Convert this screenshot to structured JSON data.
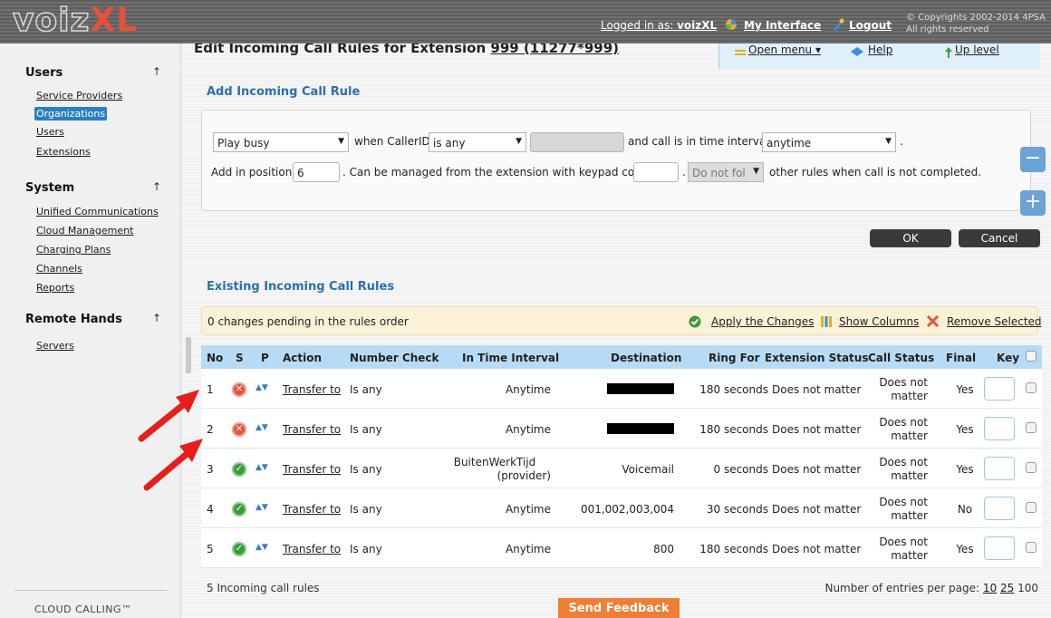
{
  "header": {
    "logo_part1": "voiz",
    "logo_part2": "XL",
    "logged_in_label": "Logged in as:",
    "logged_in_user": "voizXL",
    "my_interface": "My Interface",
    "logout": "Logout",
    "copyright_line1": "© Copyrights 2002-2014 4PSA",
    "copyright_line2": "All rights reserved"
  },
  "sidebar": {
    "sections": [
      {
        "title": "Users",
        "arrow": "↑",
        "items": [
          "Service Providers",
          "Organizations",
          "Users",
          "Extensions"
        ]
      },
      {
        "title": "System",
        "arrow": "↑",
        "items": [
          "Unified Communications",
          "Cloud Management",
          "Charging Plans",
          "Channels",
          "Reports"
        ]
      },
      {
        "title": "Remote Hands",
        "arrow": "↑",
        "items": [
          "Servers"
        ]
      }
    ],
    "active_item": "Organizations",
    "footer": "CLOUD CALLING™"
  },
  "page": {
    "title_prefix": "Edit Incoming Call Rules for Extension",
    "title_ext": "999 (11277*999)"
  },
  "toolbar": {
    "open_menu": "Open menu ▾",
    "help": "Help",
    "up_level": "Up level"
  },
  "add_rule": {
    "section_title": "Add Incoming Call Rule",
    "action_value": "Play busy",
    "when_callerid": "when CallerID",
    "callerid_value": "is any",
    "time_label": "and call is in time interval",
    "time_value": "anytime",
    "period": ".",
    "position_label": "Add in position",
    "position_value": "6",
    "keypad_label": ". Can be managed from the extension with keypad code",
    "dot": ".",
    "follow_value": "Do not fol",
    "follow_suffix": "other rules when call is not completed.",
    "ok": "OK",
    "cancel": "Cancel",
    "minus": "−",
    "plus": "+"
  },
  "existing": {
    "section_title": "Existing Incoming Call Rules",
    "pending_text": "0 changes pending in the rules order",
    "apply": "Apply the Changes",
    "show_columns": "Show Columns",
    "remove_selected": "Remove Selected",
    "columns": [
      "No",
      "S",
      "P",
      "Action",
      "Number Check",
      "In Time Interval",
      "Destination",
      "Ring For",
      "Extension Status",
      "Call Status",
      "Final",
      "Key"
    ],
    "rows": [
      {
        "no": "1",
        "status": "off",
        "action": "Transfer to",
        "check": "Is any",
        "interval": "Anytime",
        "interval2": "",
        "destination": "",
        "ring": "180 seconds",
        "ext_status": "Does not matter",
        "call1": "Does not",
        "call2": "matter",
        "final": "Yes"
      },
      {
        "no": "2",
        "status": "off",
        "action": "Transfer to",
        "check": "Is any",
        "interval": "Anytime",
        "interval2": "",
        "destination": "",
        "ring": "180 seconds",
        "ext_status": "Does not matter",
        "call1": "Does not",
        "call2": "matter",
        "final": "Yes"
      },
      {
        "no": "3",
        "status": "on",
        "action": "Transfer to",
        "check": "Is any",
        "interval": "BuitenWerkTijd",
        "interval2": "(provider)",
        "destination": "Voicemail",
        "ring": "0 seconds",
        "ext_status": "Does not matter",
        "call1": "Does not",
        "call2": "matter",
        "final": "Yes"
      },
      {
        "no": "4",
        "status": "on",
        "action": "Transfer to",
        "check": "Is any",
        "interval": "Anytime",
        "interval2": "",
        "destination": "001,002,003,004",
        "ring": "30 seconds",
        "ext_status": "Does not matter",
        "call1": "Does not",
        "call2": "matter",
        "final": "No"
      },
      {
        "no": "5",
        "status": "on",
        "action": "Transfer to",
        "check": "Is any",
        "interval": "Anytime",
        "interval2": "",
        "destination": "800",
        "ring": "180 seconds",
        "ext_status": "Does not matter",
        "call1": "Does not",
        "call2": "matter",
        "final": "Yes"
      }
    ],
    "count_text": "5 Incoming call rules",
    "per_page_label": "Number of entries per page:",
    "per_page_options": [
      "10",
      "25",
      "100"
    ]
  },
  "feedback": "Send Feedback"
}
